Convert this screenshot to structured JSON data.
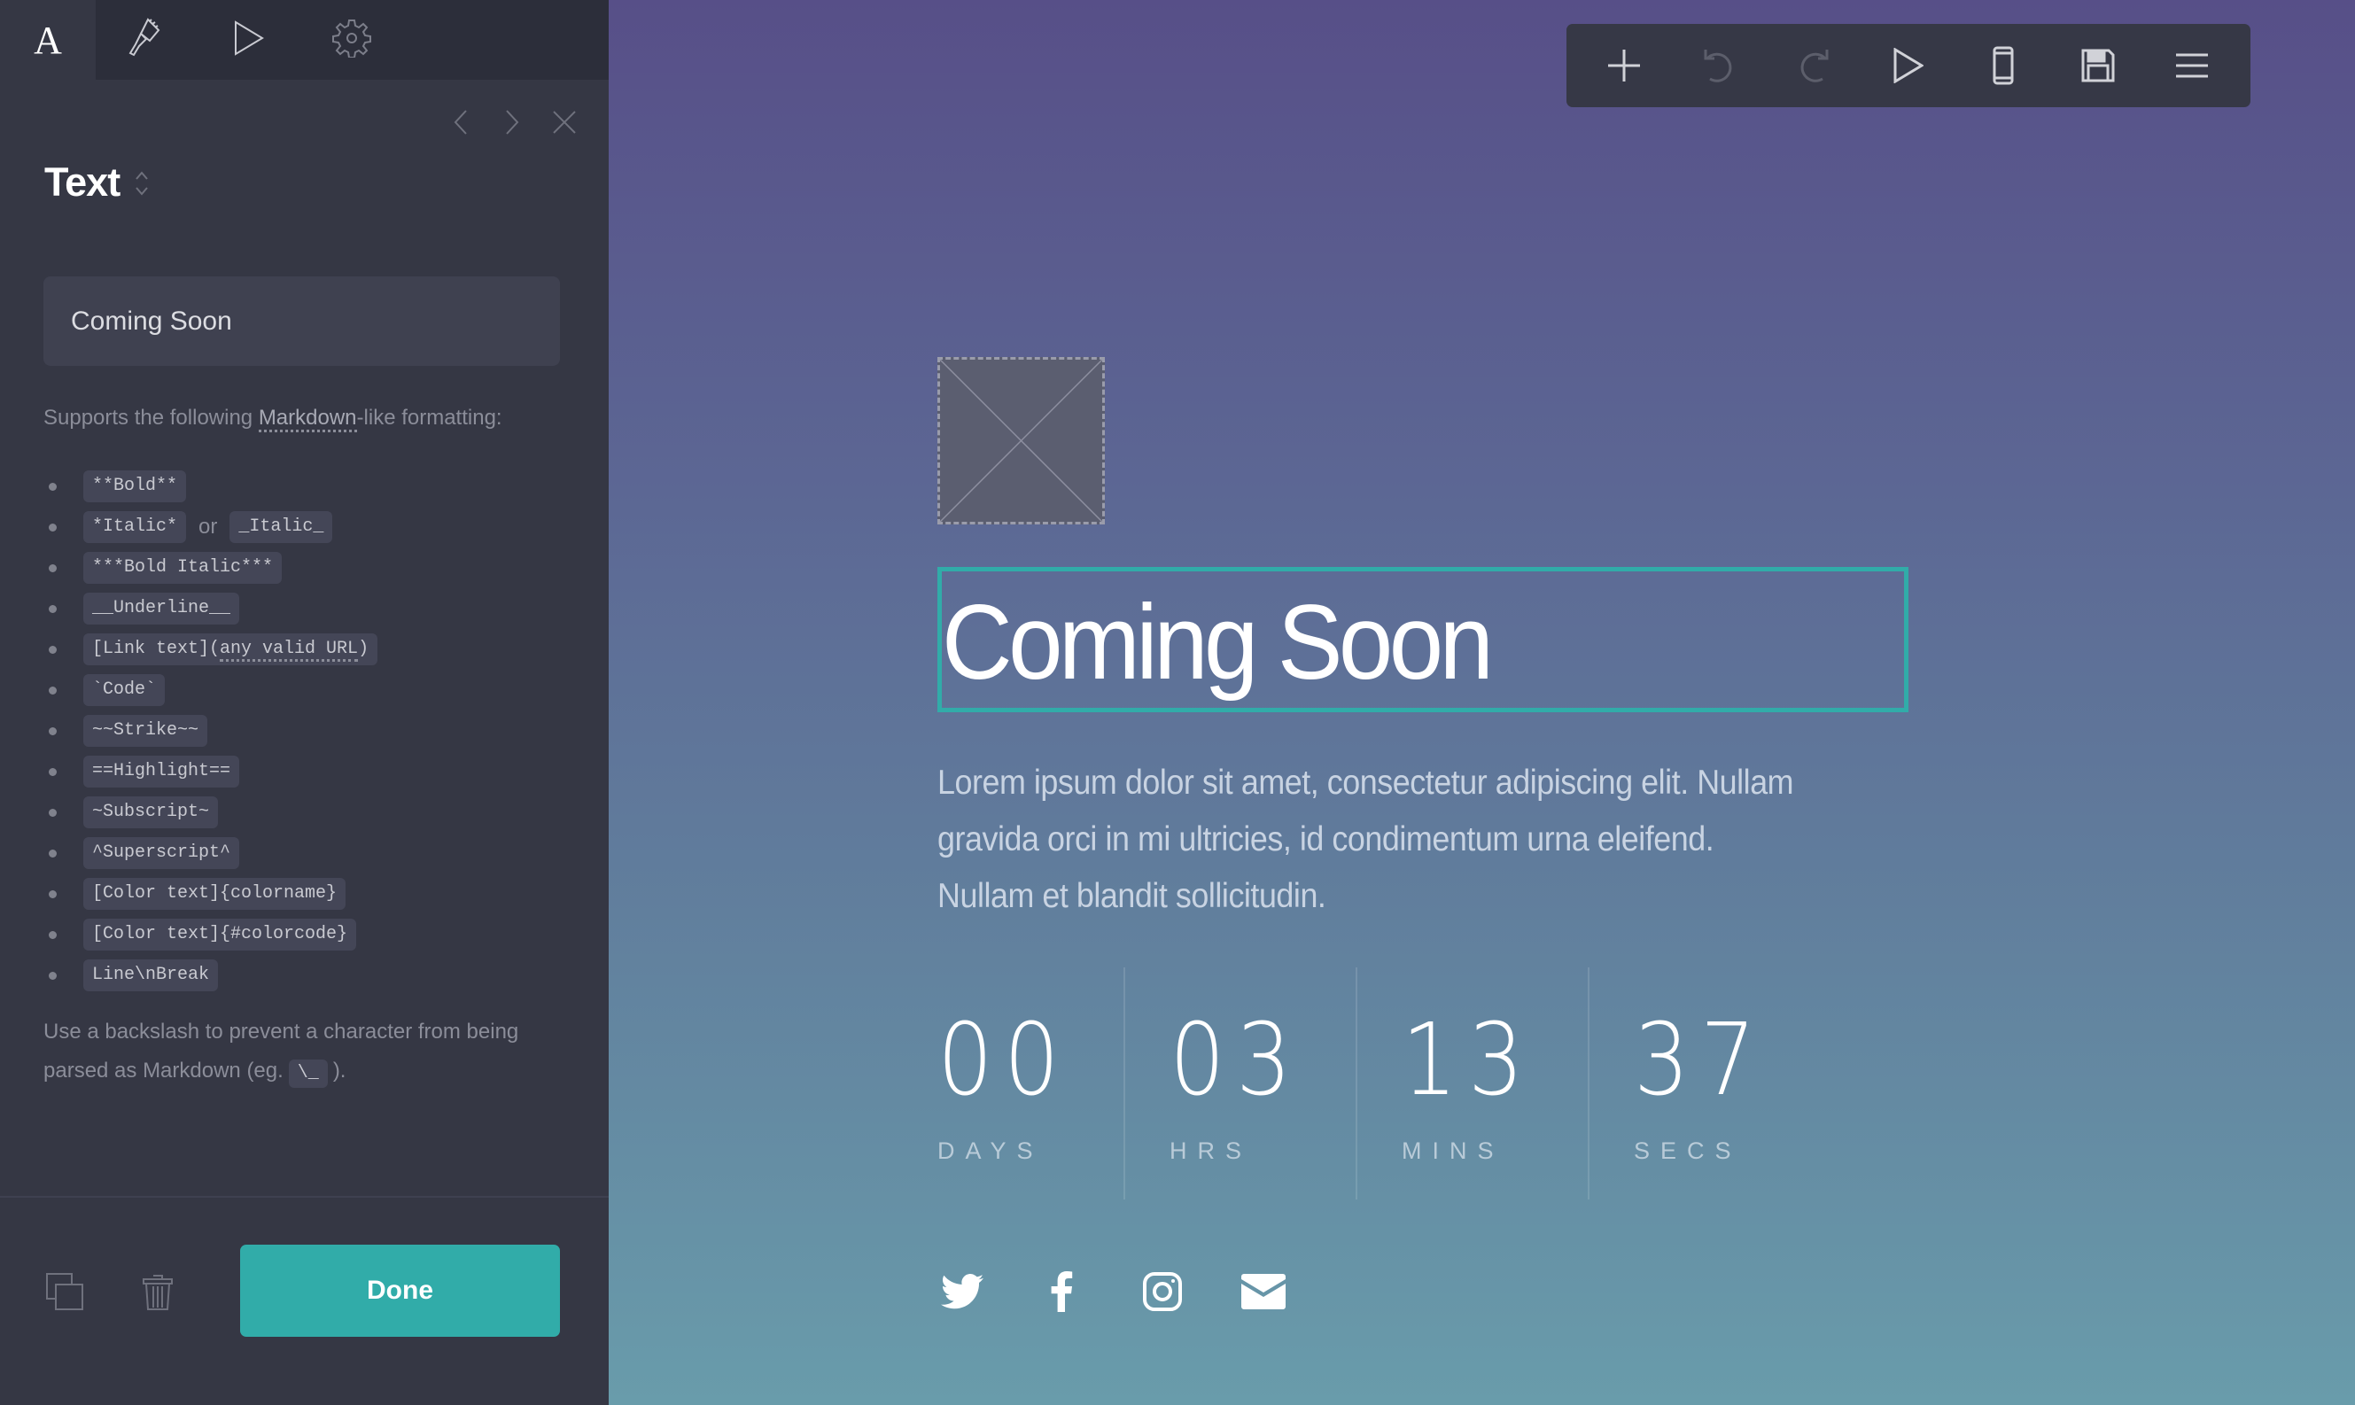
{
  "editor": {
    "tabs": [
      {
        "id": "text",
        "label": "A",
        "icon": "text-style-icon",
        "active": true
      },
      {
        "id": "style",
        "icon": "paintbrush-icon",
        "active": false
      },
      {
        "id": "preview",
        "icon": "play-icon",
        "active": false
      },
      {
        "id": "settings",
        "icon": "gear-icon",
        "active": false
      }
    ],
    "nav": {
      "prev_icon": "chevron-left-icon",
      "next_icon": "chevron-right-icon",
      "close_icon": "close-icon"
    },
    "section_title": "Text",
    "text_value": "Coming Soon",
    "help_prefix": "Supports the following ",
    "help_link": "Markdown",
    "help_suffix": "-like formatting:",
    "formats": [
      {
        "codes": [
          "**Bold**"
        ]
      },
      {
        "codes": [
          "*Italic*",
          "_Italic_"
        ],
        "joiner": "or"
      },
      {
        "codes": [
          "***Bold Italic***"
        ]
      },
      {
        "codes": [
          "__Underline__"
        ]
      },
      {
        "codes": [
          "[Link text](any valid URL)"
        ],
        "dotted_part": "any valid URL"
      },
      {
        "codes": [
          "`Code`"
        ]
      },
      {
        "codes": [
          "~~Strike~~"
        ]
      },
      {
        "codes": [
          "==Highlight=="
        ]
      },
      {
        "codes": [
          "~Subscript~"
        ]
      },
      {
        "codes": [
          "^Superscript^"
        ]
      },
      {
        "codes": [
          "[Color text]{colorname}"
        ]
      },
      {
        "codes": [
          "[Color text]{#colorcode}"
        ]
      },
      {
        "codes": [
          "Line\\nBreak"
        ]
      }
    ],
    "backslash_note_prefix": "Use a backslash to prevent a character from being parsed as Markdown (eg.",
    "backslash_example": "\\_",
    "backslash_note_suffix": ").",
    "footer": {
      "duplicate_icon": "duplicate-icon",
      "delete_icon": "trash-icon",
      "done_label": "Done"
    }
  },
  "toolbar": {
    "buttons": [
      {
        "name": "add",
        "icon": "plus-icon",
        "enabled": true
      },
      {
        "name": "undo",
        "icon": "undo-icon",
        "enabled": false
      },
      {
        "name": "redo",
        "icon": "redo-icon",
        "enabled": false
      },
      {
        "name": "preview",
        "icon": "play-icon",
        "enabled": true
      },
      {
        "name": "mobile-view",
        "icon": "mobile-icon",
        "enabled": true
      },
      {
        "name": "save",
        "icon": "floppy-disk-icon",
        "enabled": true
      },
      {
        "name": "menu",
        "icon": "hamburger-menu-icon",
        "enabled": true
      }
    ]
  },
  "page": {
    "heading": "Coming Soon",
    "paragraph": "Lorem ipsum dolor sit amet, consectetur adipiscing elit. Nullam gravida orci in mi ultricies, id condimentum urna eleifend. Nullam et blandit sollicitudin.",
    "countdown": [
      {
        "value": "00",
        "label": "DAYS"
      },
      {
        "value": "03",
        "label": "HRS"
      },
      {
        "value": "13",
        "label": "MINS"
      },
      {
        "value": "37",
        "label": "SECS"
      }
    ],
    "social": [
      {
        "name": "twitter",
        "icon": "twitter-icon"
      },
      {
        "name": "facebook",
        "icon": "facebook-icon"
      },
      {
        "name": "instagram",
        "icon": "instagram-icon"
      },
      {
        "name": "email",
        "icon": "email-icon"
      }
    ]
  },
  "colors": {
    "accent": "#31aca9",
    "panel_bg": "#353744",
    "tabbar_bg": "#2c2e3a",
    "gradient_top": "#574f88",
    "gradient_bottom": "#699cab"
  }
}
